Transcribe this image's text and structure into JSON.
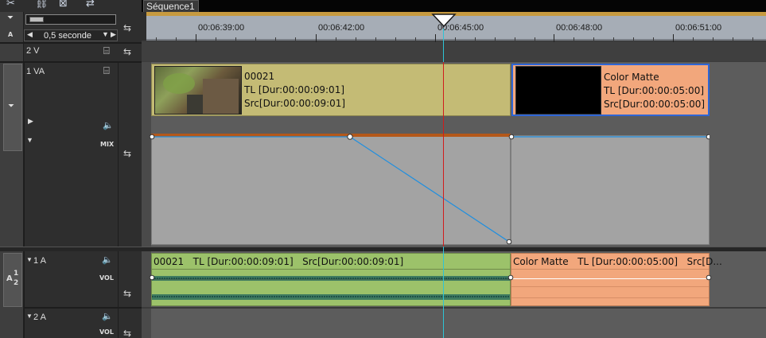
{
  "sequence_tab": "Séquence1",
  "toolbar": {
    "icons": [
      "split-icon",
      "link-icon",
      "crossfade-icon",
      "wrap-icon"
    ],
    "zoom_label": "0,5 seconde"
  },
  "ruler": {
    "timecodes": [
      "00:06:39:00",
      "00:06:42:00",
      "00:06:45:00",
      "00:06:48:00",
      "00:06:51:00"
    ]
  },
  "tracks": {
    "v2_label": "2 V",
    "va_label": "1 VA",
    "a1_label": "1 A",
    "a2_label": "2 A",
    "mix_label": "MIX",
    "vol_label": "VOL",
    "group_label_a": "A",
    "group_label_num": "1",
    "group_label_num2": "2"
  },
  "clips": {
    "video_clip": {
      "name": "00021",
      "tl": "TL [Dur:00:00:09:01]",
      "src": "Src[Dur:00:00:09:01]"
    },
    "matte_clip": {
      "name": "Color Matte",
      "tl": "TL [Dur:00:00:05:00]",
      "src": "Src[Dur:00:00:05:00]"
    },
    "audio_clip": {
      "label": "00021   TL [Dur:00:00:09:01]   Src[Dur:00:00:09:01]"
    },
    "audio_matte_clip": {
      "label": "Color Matte   TL [Dur:00:00:05:00]   Src[D..."
    }
  },
  "colors": {
    "video_clip": "#c4bb75",
    "matte_clip": "#f2a77c",
    "audio_clip": "#9cc26a",
    "playhead": "#d11c1c",
    "cursor_line": "#2ec4d6",
    "mix_line": "#1f8fe0"
  }
}
